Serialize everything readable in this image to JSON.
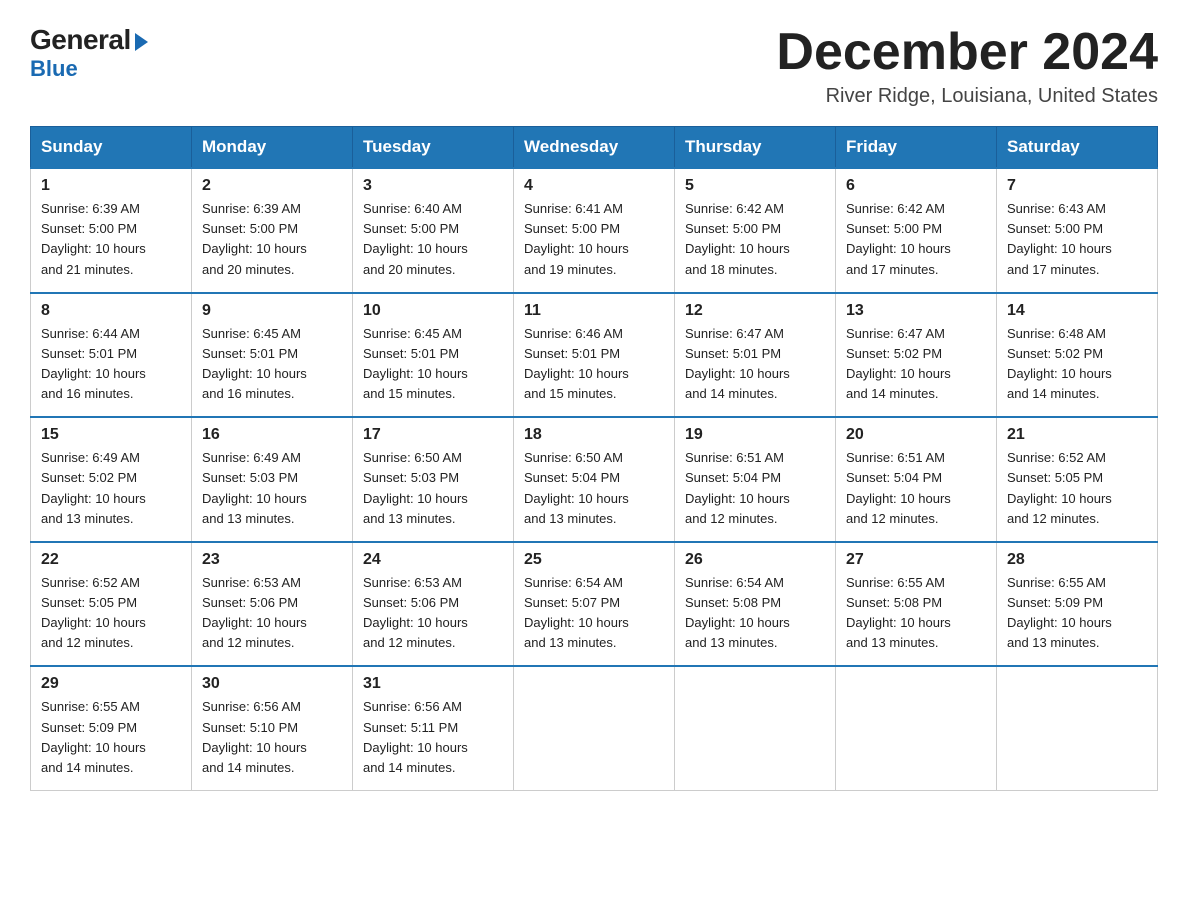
{
  "logo": {
    "general": "General",
    "blue": "Blue"
  },
  "title": "December 2024",
  "location": "River Ridge, Louisiana, United States",
  "days_of_week": [
    "Sunday",
    "Monday",
    "Tuesday",
    "Wednesday",
    "Thursday",
    "Friday",
    "Saturday"
  ],
  "weeks": [
    [
      {
        "day": "1",
        "sunrise": "6:39 AM",
        "sunset": "5:00 PM",
        "daylight": "10 hours and 21 minutes."
      },
      {
        "day": "2",
        "sunrise": "6:39 AM",
        "sunset": "5:00 PM",
        "daylight": "10 hours and 20 minutes."
      },
      {
        "day": "3",
        "sunrise": "6:40 AM",
        "sunset": "5:00 PM",
        "daylight": "10 hours and 20 minutes."
      },
      {
        "day": "4",
        "sunrise": "6:41 AM",
        "sunset": "5:00 PM",
        "daylight": "10 hours and 19 minutes."
      },
      {
        "day": "5",
        "sunrise": "6:42 AM",
        "sunset": "5:00 PM",
        "daylight": "10 hours and 18 minutes."
      },
      {
        "day": "6",
        "sunrise": "6:42 AM",
        "sunset": "5:00 PM",
        "daylight": "10 hours and 17 minutes."
      },
      {
        "day": "7",
        "sunrise": "6:43 AM",
        "sunset": "5:00 PM",
        "daylight": "10 hours and 17 minutes."
      }
    ],
    [
      {
        "day": "8",
        "sunrise": "6:44 AM",
        "sunset": "5:01 PM",
        "daylight": "10 hours and 16 minutes."
      },
      {
        "day": "9",
        "sunrise": "6:45 AM",
        "sunset": "5:01 PM",
        "daylight": "10 hours and 16 minutes."
      },
      {
        "day": "10",
        "sunrise": "6:45 AM",
        "sunset": "5:01 PM",
        "daylight": "10 hours and 15 minutes."
      },
      {
        "day": "11",
        "sunrise": "6:46 AM",
        "sunset": "5:01 PM",
        "daylight": "10 hours and 15 minutes."
      },
      {
        "day": "12",
        "sunrise": "6:47 AM",
        "sunset": "5:01 PM",
        "daylight": "10 hours and 14 minutes."
      },
      {
        "day": "13",
        "sunrise": "6:47 AM",
        "sunset": "5:02 PM",
        "daylight": "10 hours and 14 minutes."
      },
      {
        "day": "14",
        "sunrise": "6:48 AM",
        "sunset": "5:02 PM",
        "daylight": "10 hours and 14 minutes."
      }
    ],
    [
      {
        "day": "15",
        "sunrise": "6:49 AM",
        "sunset": "5:02 PM",
        "daylight": "10 hours and 13 minutes."
      },
      {
        "day": "16",
        "sunrise": "6:49 AM",
        "sunset": "5:03 PM",
        "daylight": "10 hours and 13 minutes."
      },
      {
        "day": "17",
        "sunrise": "6:50 AM",
        "sunset": "5:03 PM",
        "daylight": "10 hours and 13 minutes."
      },
      {
        "day": "18",
        "sunrise": "6:50 AM",
        "sunset": "5:04 PM",
        "daylight": "10 hours and 13 minutes."
      },
      {
        "day": "19",
        "sunrise": "6:51 AM",
        "sunset": "5:04 PM",
        "daylight": "10 hours and 12 minutes."
      },
      {
        "day": "20",
        "sunrise": "6:51 AM",
        "sunset": "5:04 PM",
        "daylight": "10 hours and 12 minutes."
      },
      {
        "day": "21",
        "sunrise": "6:52 AM",
        "sunset": "5:05 PM",
        "daylight": "10 hours and 12 minutes."
      }
    ],
    [
      {
        "day": "22",
        "sunrise": "6:52 AM",
        "sunset": "5:05 PM",
        "daylight": "10 hours and 12 minutes."
      },
      {
        "day": "23",
        "sunrise": "6:53 AM",
        "sunset": "5:06 PM",
        "daylight": "10 hours and 12 minutes."
      },
      {
        "day": "24",
        "sunrise": "6:53 AM",
        "sunset": "5:06 PM",
        "daylight": "10 hours and 12 minutes."
      },
      {
        "day": "25",
        "sunrise": "6:54 AM",
        "sunset": "5:07 PM",
        "daylight": "10 hours and 13 minutes."
      },
      {
        "day": "26",
        "sunrise": "6:54 AM",
        "sunset": "5:08 PM",
        "daylight": "10 hours and 13 minutes."
      },
      {
        "day": "27",
        "sunrise": "6:55 AM",
        "sunset": "5:08 PM",
        "daylight": "10 hours and 13 minutes."
      },
      {
        "day": "28",
        "sunrise": "6:55 AM",
        "sunset": "5:09 PM",
        "daylight": "10 hours and 13 minutes."
      }
    ],
    [
      {
        "day": "29",
        "sunrise": "6:55 AM",
        "sunset": "5:09 PM",
        "daylight": "10 hours and 14 minutes."
      },
      {
        "day": "30",
        "sunrise": "6:56 AM",
        "sunset": "5:10 PM",
        "daylight": "10 hours and 14 minutes."
      },
      {
        "day": "31",
        "sunrise": "6:56 AM",
        "sunset": "5:11 PM",
        "daylight": "10 hours and 14 minutes."
      },
      null,
      null,
      null,
      null
    ]
  ],
  "labels": {
    "sunrise": "Sunrise:",
    "sunset": "Sunset:",
    "daylight": "Daylight:"
  }
}
